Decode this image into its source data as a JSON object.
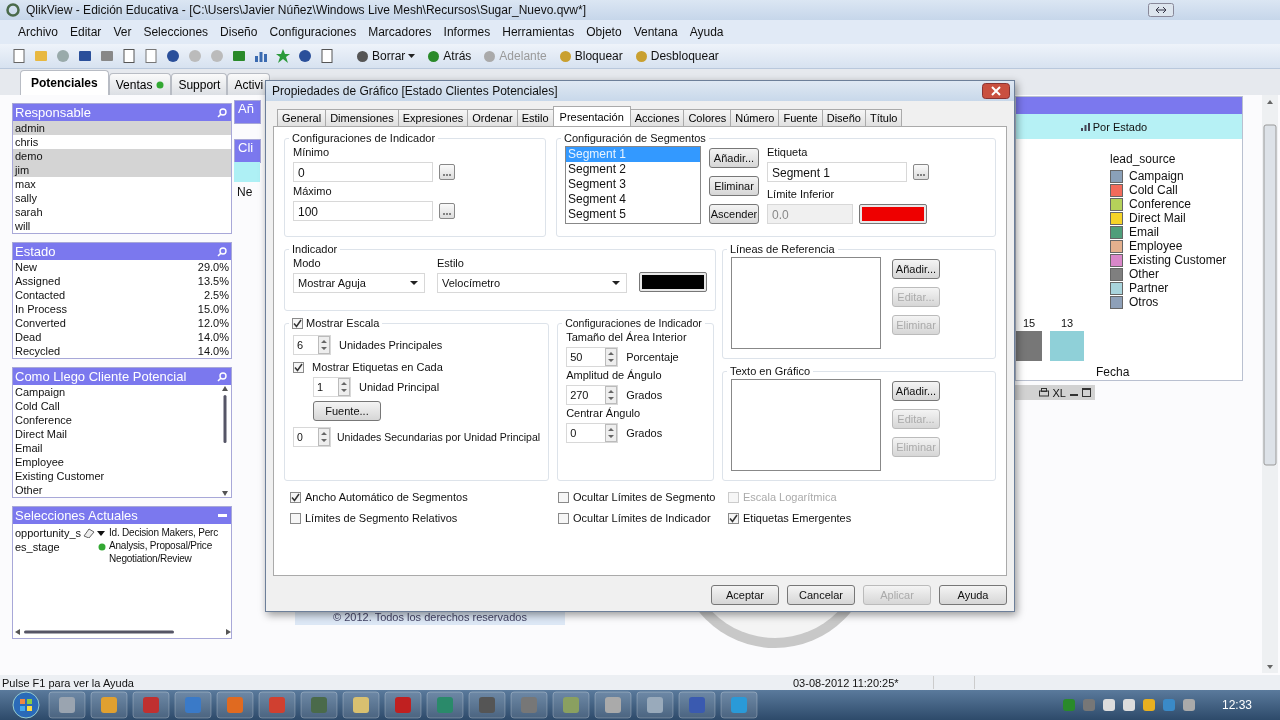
{
  "window": {
    "title": "QlikView - Edición Educativa - [C:\\Users\\Javier Núñez\\Windows Live Mesh\\Recursos\\Sugar_Nuevo.qvw*]"
  },
  "menu": [
    "Archivo",
    "Editar",
    "Ver",
    "Selecciones",
    "Diseño",
    "Configuraciones",
    "Marcadores",
    "Informes",
    "Herramientas",
    "Objeto",
    "Ventana",
    "Ayuda"
  ],
  "toolbar": [
    {
      "label": "Borrar",
      "kind": "dropdown",
      "disabled": false
    },
    {
      "label": "Atrás",
      "kind": "button",
      "disabled": false
    },
    {
      "label": "Adelante",
      "kind": "button",
      "disabled": true
    },
    {
      "label": "Bloquear",
      "kind": "button",
      "disabled": false
    },
    {
      "label": "Desbloquear",
      "kind": "button",
      "disabled": false
    }
  ],
  "sheet_tabs": [
    {
      "label": "Potenciales",
      "selected": true,
      "marked": false
    },
    {
      "label": "Ventas",
      "selected": false,
      "marked": true
    },
    {
      "label": "Support",
      "selected": false,
      "marked": false
    },
    {
      "label": "Activi",
      "selected": false,
      "marked": false
    }
  ],
  "responsable": {
    "title": "Responsable",
    "items": [
      {
        "label": "admin",
        "excluded": true
      },
      {
        "label": "chris",
        "excluded": false
      },
      {
        "label": "demo",
        "excluded": true
      },
      {
        "label": "jim",
        "excluded": true
      },
      {
        "label": "max",
        "excluded": false
      },
      {
        "label": "sally",
        "excluded": false
      },
      {
        "label": "sarah",
        "excluded": false
      },
      {
        "label": "will",
        "excluded": false
      }
    ]
  },
  "estado": {
    "title": "Estado",
    "items": [
      {
        "label": "New",
        "value": "29.0%"
      },
      {
        "label": "Assigned",
        "value": "13.5%"
      },
      {
        "label": "Contacted",
        "value": "2.5%"
      },
      {
        "label": "In Process",
        "value": "15.0%"
      },
      {
        "label": "Converted",
        "value": "12.0%"
      },
      {
        "label": "Dead",
        "value": "14.0%"
      },
      {
        "label": "Recycled",
        "value": "14.0%"
      }
    ]
  },
  "como_llego": {
    "title": "Como Llego Cliente Potencial",
    "items": [
      "Campaign",
      "Cold Call",
      "Conference",
      "Direct Mail",
      "Email",
      "Employee",
      "Existing Customer",
      "Other"
    ]
  },
  "selecciones": {
    "title": "Selecciones Actuales",
    "fields": [
      "opportunity_s",
      "es_stage"
    ],
    "values": [
      "Id. Decision Makers, Perc",
      "Analysis, Proposal/Price",
      "Negotiation/Review"
    ]
  },
  "partial_objects": {
    "titles": [
      "Añ",
      "Cli"
    ],
    "row": "Ne"
  },
  "footer": "© 2012. Todos los derechos reservados",
  "chart": {
    "caption": "Por Estado",
    "legend_title": "lead_source",
    "legend": [
      {
        "label": "Campaign",
        "color": "#8aa0b8"
      },
      {
        "label": "Cold Call",
        "color": "#f26b5b"
      },
      {
        "label": "Conference",
        "color": "#b5d15a"
      },
      {
        "label": "Direct Mail",
        "color": "#f5d327"
      },
      {
        "label": "Email",
        "color": "#4f9e7a"
      },
      {
        "label": "Employee",
        "color": "#e4b08e"
      },
      {
        "label": "Existing Customer",
        "color": "#d987c9"
      },
      {
        "label": "Other",
        "color": "#7f7f7f"
      },
      {
        "label": "Partner",
        "color": "#a9d4dc"
      },
      {
        "label": "Otros",
        "color": "#8ea0b8"
      }
    ],
    "bars": [
      {
        "label": "15",
        "color": "#777777"
      },
      {
        "label": "13",
        "color": "#8fd0d8"
      }
    ],
    "xlabel": "Fecha"
  },
  "mini_object": {
    "label": "XL"
  },
  "status_bar": {
    "hint": "Pulse F1 para ver la Ayuda",
    "timestamp": "03-08-2012 11:20:25*"
  },
  "taskbar": {
    "clock": "12:33"
  },
  "dialog": {
    "title": "Propiedades de Gráfico [Estado Clientes Potenciales]",
    "tabs": [
      {
        "label": "General",
        "selected": false
      },
      {
        "label": "Dimensiones",
        "selected": false
      },
      {
        "label": "Expresiones",
        "selected": false
      },
      {
        "label": "Ordenar",
        "selected": false
      },
      {
        "label": "Estilo",
        "selected": false
      },
      {
        "label": "Presentación",
        "selected": true
      },
      {
        "label": "Acciones",
        "selected": false
      },
      {
        "label": "Colores",
        "selected": false
      },
      {
        "label": "Número",
        "selected": false
      },
      {
        "label": "Fuente",
        "selected": false
      },
      {
        "label": "Diseño",
        "selected": false
      },
      {
        "label": "Título",
        "selected": false
      }
    ],
    "indicator_settings": {
      "title": "Configuraciones de Indicador",
      "fields": [
        {
          "label": "Mínimo",
          "value": "0"
        },
        {
          "label": "Máximo",
          "value": "100"
        }
      ]
    },
    "segments": {
      "title": "Configuración de Segmentos",
      "items": [
        {
          "label": "Segment 1",
          "selected": true
        },
        {
          "label": "Segment 2",
          "selected": false
        },
        {
          "label": "Segment 3",
          "selected": false
        },
        {
          "label": "Segment 4",
          "selected": false
        },
        {
          "label": "Segment 5",
          "selected": false
        }
      ],
      "buttons": [
        "Añadir...",
        "Eliminar",
        "Ascender"
      ],
      "label_field": {
        "label": "Etiqueta",
        "value": "Segment 1"
      },
      "lower_limit": {
        "label": "Límite Inferior",
        "value": "0.0",
        "disabled": true
      },
      "color": "#ee0000"
    },
    "indicator": {
      "title": "Indicador",
      "mode": {
        "label": "Modo",
        "value": "Mostrar Aguja"
      },
      "style": {
        "label": "Estilo",
        "value": "Velocímetro"
      },
      "color": "#000000"
    },
    "reference_lines": {
      "title": "Líneas de Referencia",
      "buttons": [
        {
          "label": "Añadir...",
          "disabled": false
        },
        {
          "label": "Editar...",
          "disabled": true
        },
        {
          "label": "Eliminar",
          "disabled": true
        }
      ]
    },
    "scale": {
      "show_scale": {
        "label": "Mostrar Escala",
        "checked": true
      },
      "major_units": {
        "value": "6",
        "label": "Unidades Principales"
      },
      "show_labels": {
        "label": "Mostrar Etiquetas en Cada",
        "checked": true
      },
      "label_every": {
        "value": "1",
        "label": "Unidad Principal"
      },
      "font_button": "Fuente...",
      "minor_units": {
        "value": "0",
        "label": "Unidades Secundarias por Unidad Principal"
      }
    },
    "gauge_settings": {
      "title": "Configuraciones de Indicador",
      "fields": [
        {
          "label": "Tamaño del Área Interior",
          "value": "50",
          "unit": "Porcentaje"
        },
        {
          "label": "Amplitud de Ángulo",
          "value": "270",
          "unit": "Grados"
        },
        {
          "label": "Centrar Ángulo",
          "value": "0",
          "unit": "Grados"
        }
      ]
    },
    "chart_text": {
      "title": "Texto en Gráfico",
      "buttons": [
        {
          "label": "Añadir...",
          "disabled": false
        },
        {
          "label": "Editar...",
          "disabled": true
        },
        {
          "label": "Eliminar",
          "disabled": true
        }
      ]
    },
    "options": [
      {
        "label": "Ancho Automático de Segmentos",
        "checked": true,
        "disabled": false
      },
      {
        "label": "Ocultar Límites de Segmento",
        "checked": false,
        "disabled": false
      },
      {
        "label": "Escala Logarítmica",
        "checked": false,
        "disabled": true
      },
      {
        "label": "Límites de Segmento Relativos",
        "checked": false,
        "disabled": false
      },
      {
        "label": "Ocultar Límites de Indicador",
        "checked": false,
        "disabled": false
      },
      {
        "label": "Etiquetas Emergentes",
        "checked": true,
        "disabled": false
      }
    ],
    "buttons": [
      {
        "label": "Aceptar",
        "disabled": false
      },
      {
        "label": "Cancelar",
        "disabled": false
      },
      {
        "label": "Aplicar",
        "disabled": true
      },
      {
        "label": "Ayuda",
        "disabled": false
      }
    ]
  }
}
